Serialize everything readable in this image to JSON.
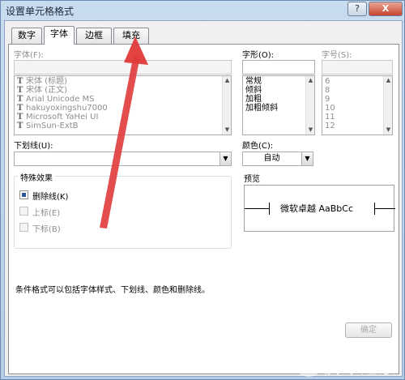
{
  "window": {
    "title": "设置单元格格式",
    "help_label": "?",
    "close_label": "X"
  },
  "tabs": [
    {
      "label": "数字"
    },
    {
      "label": "字体"
    },
    {
      "label": "边框"
    },
    {
      "label": "填充"
    }
  ],
  "font": {
    "label": "字体(F):",
    "input_value": "",
    "items": [
      "宋体 (标题)",
      "宋体 (正文)",
      "Arial Unicode MS",
      "hakuyoxingshu7000",
      "Microsoft YaHei UI",
      "SimSun-ExtB"
    ]
  },
  "style": {
    "label": "字形(O):",
    "input_value": "",
    "items": [
      "常规",
      "倾斜",
      "加粗",
      "加粗倾斜"
    ]
  },
  "size": {
    "label": "字号(S):",
    "input_value": "",
    "items": [
      "6",
      "8",
      "9",
      "10",
      "11",
      "12"
    ]
  },
  "underline": {
    "label": "下划线(U):",
    "value": ""
  },
  "color": {
    "label": "颜色(C):",
    "value": "自动"
  },
  "effects": {
    "title": "特殊效果",
    "items": [
      {
        "label": "删除线(K)",
        "checked": true,
        "enabled": true
      },
      {
        "label": "上标(E)",
        "checked": false,
        "enabled": false
      },
      {
        "label": "下标(B)",
        "checked": false,
        "enabled": false
      }
    ]
  },
  "preview": {
    "title": "预览",
    "text": "微软卓越  AaBbCc"
  },
  "description": "条件格式可以包括字体样式、下划线、颜色和删除线。",
  "buttons": {
    "ok_label": "确定"
  },
  "watermark": {
    "site": "jb51.net",
    "brand": "脚本之家"
  },
  "colors": {
    "arrow": "#e03a3a",
    "title_bar": "#c9dcef"
  }
}
